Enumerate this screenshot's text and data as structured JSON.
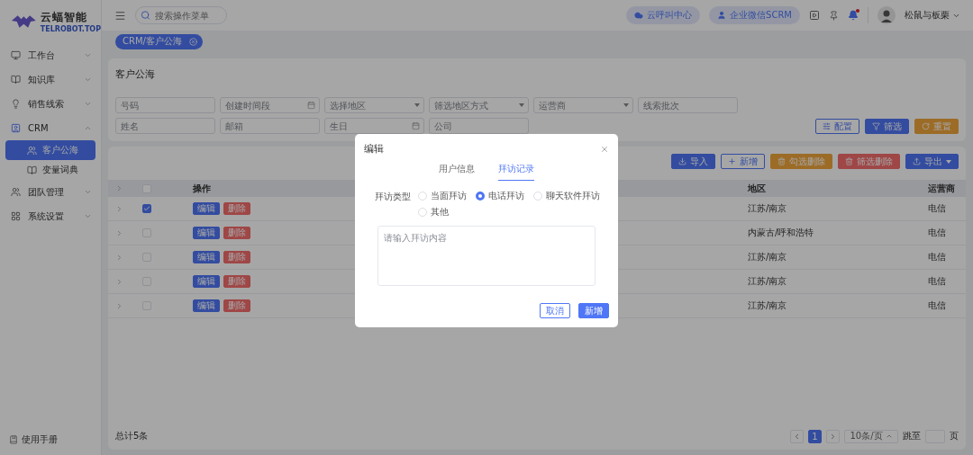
{
  "sidebar": {
    "brand": "云蝠智能",
    "brand_sub": "TELROBOT.TOP",
    "items": [
      {
        "label": "工作台",
        "expanded": false
      },
      {
        "label": "知识库",
        "expanded": false
      },
      {
        "label": "销售线索",
        "expanded": false
      },
      {
        "label": "CRM",
        "expanded": true,
        "children": [
          {
            "label": "客户公海",
            "selected": true
          },
          {
            "label": "变量词典",
            "selected": false
          }
        ]
      },
      {
        "label": "团队管理",
        "expanded": false
      },
      {
        "label": "系统设置",
        "expanded": false
      }
    ],
    "manual": "使用手册"
  },
  "header": {
    "search": {
      "placeholder": "搜索操作菜单"
    },
    "pills": [
      "云呼叫中心",
      "企业微信SCRM"
    ],
    "notification_dot": true,
    "user": "松鼠与板栗"
  },
  "tags": [
    {
      "label": "CRM/客户公海",
      "selected": true
    }
  ],
  "page_title": "客户公海",
  "filters": [
    {
      "placeholder": "号码",
      "kind": "text"
    },
    {
      "placeholder": "创建时间段",
      "kind": "date"
    },
    {
      "placeholder": "选择地区",
      "kind": "select"
    },
    {
      "placeholder": "筛选地区方式",
      "kind": "select"
    },
    {
      "placeholder": "运营商",
      "kind": "select"
    },
    {
      "placeholder": "线索批次",
      "kind": "text"
    },
    {
      "placeholder": "姓名",
      "kind": "text"
    },
    {
      "placeholder": "邮箱",
      "kind": "text"
    },
    {
      "placeholder": "生日",
      "kind": "date"
    },
    {
      "placeholder": "公司",
      "kind": "text"
    }
  ],
  "filter_buttons": [
    {
      "label": "配置",
      "kind": "outline"
    },
    {
      "label": "筛选",
      "kind": "primary"
    },
    {
      "label": "重置",
      "kind": "warning"
    }
  ],
  "toolbar": [
    {
      "label": "导入",
      "kind": "primary"
    },
    {
      "label": "新增",
      "kind": "outline"
    },
    {
      "label": "勾选删除",
      "kind": "warning"
    },
    {
      "label": "筛选删除",
      "kind": "danger"
    },
    {
      "label": "导出",
      "kind": "primary",
      "dropdown": true
    }
  ],
  "table": {
    "header_checked": false,
    "columns": [
      "操作",
      "地区",
      "运营商"
    ],
    "rows": [
      {
        "checked": true,
        "actions": [
          {
            "label": "编辑",
            "kind": "primary"
          },
          {
            "label": "删除",
            "kind": "danger"
          }
        ],
        "region": "江苏/南京",
        "carrier": "电信"
      },
      {
        "checked": false,
        "actions": [
          {
            "label": "编辑",
            "kind": "primary"
          },
          {
            "label": "删除",
            "kind": "danger"
          }
        ],
        "region": "内蒙古/呼和浩特",
        "carrier": "电信"
      },
      {
        "checked": false,
        "actions": [
          {
            "label": "编辑",
            "kind": "primary"
          },
          {
            "label": "删除",
            "kind": "danger"
          }
        ],
        "region": "江苏/南京",
        "carrier": "电信"
      },
      {
        "checked": false,
        "actions": [
          {
            "label": "编辑",
            "kind": "primary"
          },
          {
            "label": "删除",
            "kind": "danger"
          }
        ],
        "region": "江苏/南京",
        "carrier": "电信"
      },
      {
        "checked": false,
        "actions": [
          {
            "label": "编辑",
            "kind": "primary"
          },
          {
            "label": "删除",
            "kind": "danger"
          }
        ],
        "region": "江苏/南京",
        "carrier": "电信"
      }
    ]
  },
  "total": "总计5条",
  "pagination": {
    "pages": [
      {
        "label": "1",
        "selected": true
      }
    ],
    "page_size": "10条/页",
    "jump_label": "跳至",
    "jump_suffix": "页"
  },
  "modal": {
    "title": "编辑",
    "tabs": [
      {
        "label": "用户信息",
        "selected": false
      },
      {
        "label": "拜访记录",
        "selected": true
      }
    ],
    "visit_type_label": "拜访类型",
    "options": [
      {
        "label": "当面拜访",
        "selected": false
      },
      {
        "label": "电话拜访",
        "selected": true
      },
      {
        "label": "聊天软件拜访",
        "selected": false
      },
      {
        "label": "其他",
        "selected": false
      }
    ],
    "content": {
      "placeholder": "请输入拜访内容"
    },
    "buttons": [
      {
        "label": "取消",
        "kind": "outline"
      },
      {
        "label": "新增",
        "kind": "primary"
      }
    ]
  }
}
